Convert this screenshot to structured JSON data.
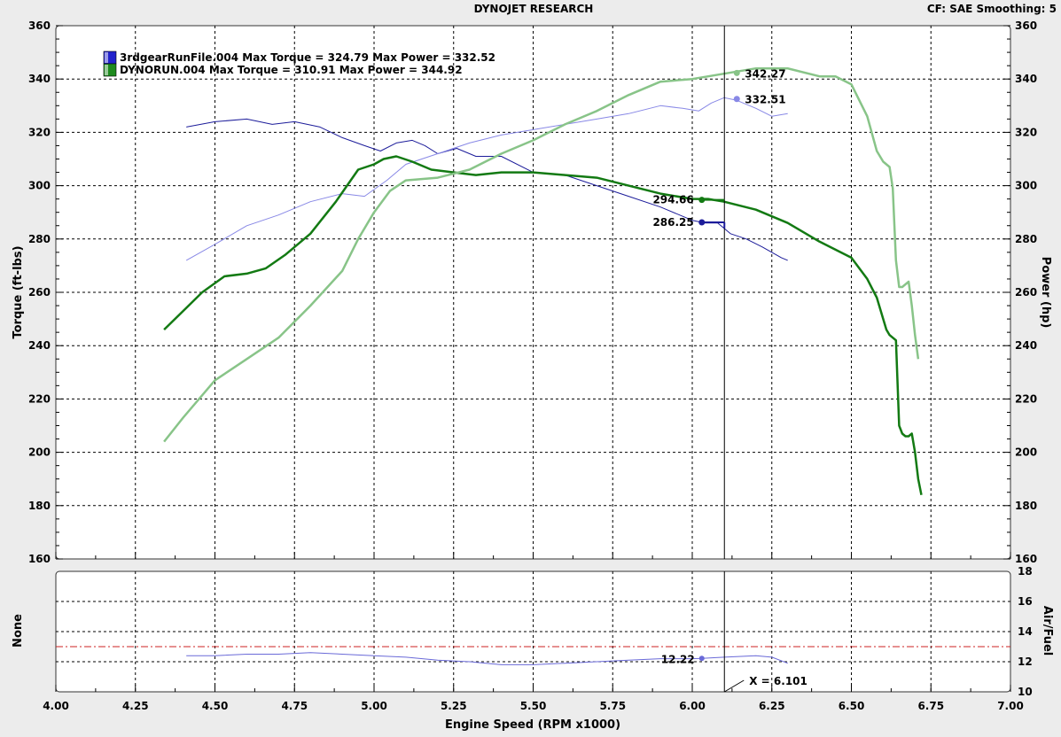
{
  "header": {
    "title": "DYNOJET RESEARCH",
    "cf": "CF: SAE  Smoothing: 5"
  },
  "legend": [
    {
      "label": "3rdgearRunFile.004 Max Torque = 324.79 Max Power = 332.52",
      "color": "#2222cc"
    },
    {
      "label": "DYNORUN.004 Max Torque = 310.91 Max Power = 344.92",
      "color": "#1e8a1e"
    }
  ],
  "chart_data": [
    {
      "type": "line",
      "xlabel": "Engine Speed (RPM x1000)",
      "ylabel": "Torque (ft-lbs)",
      "y2label": "Power (hp)",
      "xlim": [
        4.0,
        7.0
      ],
      "ylim": [
        160,
        360
      ],
      "y2lim": [
        160,
        360
      ],
      "xticks": [
        "4.00",
        "4.25",
        "4.50",
        "4.75",
        "5.00",
        "5.25",
        "5.50",
        "5.75",
        "6.00",
        "6.25",
        "6.50",
        "6.75",
        "7.00"
      ],
      "yticks": [
        "160",
        "180",
        "200",
        "220",
        "240",
        "260",
        "280",
        "300",
        "320",
        "340",
        "360"
      ],
      "grid": true,
      "legend_position": "top-left",
      "cursor_x": 6.101,
      "series": [
        {
          "name": "3rdgearRunFile.004",
          "metric": "torque",
          "color": "#1c1c9a",
          "width": 1,
          "x": [
            4.41,
            4.5,
            4.6,
            4.68,
            4.75,
            4.83,
            4.9,
            4.97,
            5.02,
            5.07,
            5.12,
            5.16,
            5.2,
            5.26,
            5.32,
            5.4,
            5.5,
            5.6,
            5.7,
            5.8,
            5.9,
            6.0,
            6.04,
            6.08,
            6.12,
            6.17,
            6.22,
            6.28,
            6.3
          ],
          "y": [
            322,
            324,
            325,
            323,
            324,
            322,
            318,
            315,
            313,
            316,
            317,
            315,
            312,
            314,
            311,
            311,
            305,
            304,
            300,
            296,
            292,
            287,
            286,
            286,
            282,
            280,
            277,
            273,
            272
          ]
        },
        {
          "name": "3rdgearRunFile.004",
          "metric": "power",
          "color": "#8888e6",
          "width": 1,
          "x": [
            4.41,
            4.5,
            4.6,
            4.7,
            4.8,
            4.9,
            4.97,
            5.04,
            5.1,
            5.2,
            5.3,
            5.4,
            5.5,
            5.6,
            5.7,
            5.8,
            5.9,
            5.97,
            6.02,
            6.06,
            6.1,
            6.14,
            6.2,
            6.25,
            6.3
          ],
          "y": [
            272,
            278,
            285,
            289,
            294,
            297,
            296,
            302,
            308,
            312,
            316,
            319,
            321,
            323,
            325,
            327,
            330,
            329,
            328,
            331,
            333,
            332,
            329,
            326,
            327
          ]
        },
        {
          "name": "DYNORUN.004",
          "metric": "torque",
          "color": "#137a13",
          "width": 2.5,
          "x": [
            4.34,
            4.4,
            4.46,
            4.53,
            4.6,
            4.66,
            4.72,
            4.8,
            4.88,
            4.95,
            5.0,
            5.03,
            5.07,
            5.12,
            5.18,
            5.25,
            5.32,
            5.4,
            5.5,
            5.6,
            5.7,
            5.8,
            5.9,
            6.0,
            6.05,
            6.1,
            6.2,
            6.3,
            6.4,
            6.5,
            6.55,
            6.58,
            6.6,
            6.61,
            6.62,
            6.63,
            6.64,
            6.65,
            6.66,
            6.67,
            6.68,
            6.69,
            6.7,
            6.71,
            6.72
          ],
          "y": [
            246,
            253,
            260,
            266,
            267,
            269,
            274,
            282,
            294,
            306,
            308,
            310,
            311,
            309,
            306,
            305,
            304,
            305,
            305,
            304,
            303,
            300,
            297,
            295,
            295,
            294,
            291,
            286,
            279,
            273,
            265,
            258,
            250,
            246,
            244,
            243,
            242,
            210,
            207,
            206,
            206,
            207,
            200,
            190,
            184
          ]
        },
        {
          "name": "DYNORUN.004",
          "metric": "power",
          "color": "#88c488",
          "width": 2.5,
          "x": [
            4.34,
            4.4,
            4.5,
            4.6,
            4.7,
            4.8,
            4.9,
            4.95,
            5.0,
            5.05,
            5.1,
            5.2,
            5.3,
            5.4,
            5.5,
            5.6,
            5.7,
            5.8,
            5.9,
            6.0,
            6.1,
            6.2,
            6.3,
            6.4,
            6.45,
            6.5,
            6.55,
            6.58,
            6.6,
            6.62,
            6.63,
            6.64,
            6.65,
            6.66,
            6.67,
            6.68,
            6.69,
            6.7,
            6.71
          ],
          "y": [
            204,
            213,
            227,
            235,
            243,
            255,
            268,
            280,
            290,
            298,
            302,
            303,
            306,
            312,
            317,
            323,
            328,
            334,
            339,
            340,
            342,
            344,
            344,
            341,
            341,
            338,
            326,
            313,
            309,
            307,
            299,
            272,
            262,
            262,
            263,
            264,
            255,
            244,
            235
          ]
        }
      ],
      "annotations": [
        {
          "text": "342.27",
          "x": 6.14,
          "y": 342.27,
          "color": "#88c488"
        },
        {
          "text": "332.51",
          "x": 6.14,
          "y": 332.51,
          "color": "#8888e6"
        },
        {
          "text": "294.66",
          "x": 6.03,
          "y": 294.66,
          "color": "#137a13"
        },
        {
          "text": "286.25",
          "x": 6.03,
          "y": 286.25,
          "color": "#1c1c9a"
        }
      ]
    },
    {
      "type": "line",
      "ylabel": "None",
      "y2label": "Air/Fuel",
      "xlim": [
        4.0,
        7.0
      ],
      "ylim": [
        10,
        18
      ],
      "yticks": [
        "10",
        "12",
        "14",
        "16",
        "18"
      ],
      "grid": true,
      "reference_line": 13,
      "cursor_label": "X = 6.101",
      "series": [
        {
          "name": "3rdgearRunFile.004",
          "metric": "air_fuel",
          "color": "#6a6ad8",
          "x": [
            4.41,
            4.5,
            4.6,
            4.7,
            4.8,
            4.9,
            5.0,
            5.1,
            5.2,
            5.3,
            5.4,
            5.5,
            5.6,
            5.7,
            5.8,
            5.9,
            6.0,
            6.03,
            6.1,
            6.2,
            6.25,
            6.3
          ],
          "y": [
            12.4,
            12.4,
            12.5,
            12.5,
            12.6,
            12.5,
            12.4,
            12.3,
            12.1,
            12.0,
            11.8,
            11.8,
            11.9,
            12.0,
            12.1,
            12.2,
            12.2,
            12.22,
            12.3,
            12.4,
            12.3,
            11.9
          ]
        }
      ],
      "annotations": [
        {
          "text": "12.22",
          "x": 6.03,
          "y": 12.22,
          "color": "#6a6ad8"
        }
      ]
    }
  ]
}
